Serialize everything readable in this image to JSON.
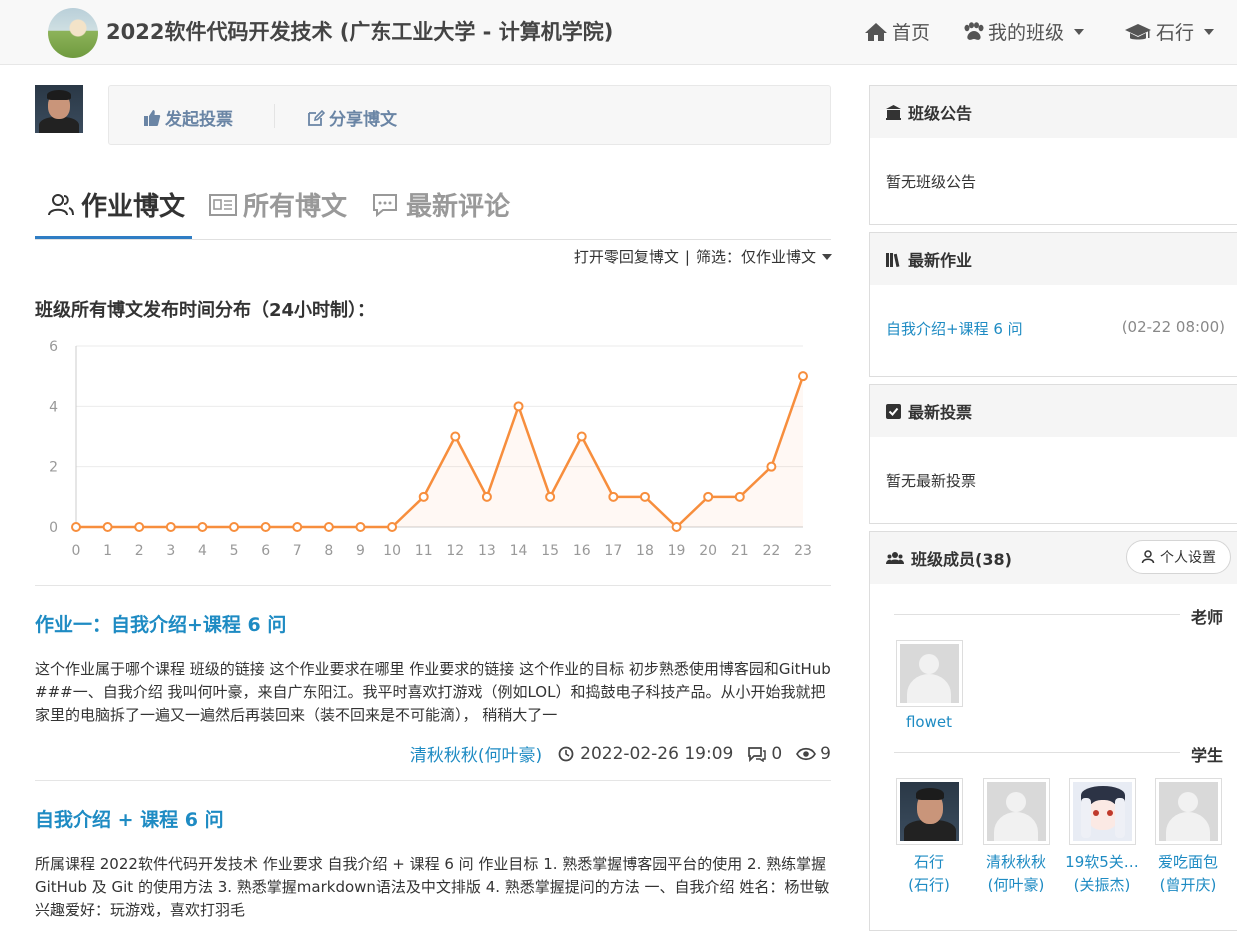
{
  "navbar": {
    "title": "2022软件代码开发技术 (广东工业大学 - 计算机学院)",
    "home": "首页",
    "my_class": "我的班级",
    "user": "石行"
  },
  "actions": {
    "vote": "发起投票",
    "share": "分享博文"
  },
  "tabs": [
    {
      "label": "作业博文",
      "icon": "users-icon"
    },
    {
      "label": "所有博文",
      "icon": "blog-icon"
    },
    {
      "label": "最新评论",
      "icon": "comments-icon"
    }
  ],
  "filter": {
    "zero_reply": "打开零回复博文",
    "separator": "|",
    "filter_label": "筛选：仅作业博文"
  },
  "chart_title": "班级所有博文发布时间分布（24小时制）：",
  "chart_data": {
    "type": "area",
    "title": "",
    "categories": [
      "0",
      "1",
      "2",
      "3",
      "4",
      "5",
      "6",
      "7",
      "8",
      "9",
      "10",
      "11",
      "12",
      "13",
      "14",
      "15",
      "16",
      "17",
      "18",
      "19",
      "20",
      "21",
      "22",
      "23"
    ],
    "series": [
      {
        "values": [
          0,
          0,
          0,
          0,
          0,
          0,
          0,
          0,
          0,
          0,
          0,
          1,
          3,
          1,
          4,
          1,
          3,
          1,
          1,
          0,
          1,
          1,
          2,
          5
        ]
      }
    ],
    "ylim": [
      0,
      6
    ],
    "yticks": [
      0,
      2,
      4,
      6
    ],
    "color": "#f78e3d",
    "grid": true
  },
  "posts": [
    {
      "title": "作业一：自我介绍+课程 6 问",
      "summary": "这个作业属于哪个课程 班级的链接 这个作业要求在哪里 作业要求的链接 这个作业的目标 初步熟悉使用博客园和GitHub ###一、自我介绍 我叫何叶豪，来自广东阳江。我平时喜欢打游戏（例如LOL）和捣鼓电子科技产品。从小开始我就把家里的电脑拆了一遍又一遍然后再装回来（装不回来是不可能滴）， 稍稍大了一",
      "author": "清秋秋秋(何叶豪)",
      "time": "2022-02-26 19:09",
      "comments": "0",
      "views": "9"
    },
    {
      "title": "自我介绍 + 课程 6 问",
      "summary": "所属课程 2022软件代码开发技术 作业要求 自我介绍 + 课程 6 问 作业目标 1. 熟悉掌握博客园平台的使用 2. 熟练掌握 GitHub 及 Git 的使用方法 3. 熟悉掌握markdown语法及中文排版 4. 熟悉掌握提问的方法 一、自我介绍 姓名：杨世敏 兴趣爱好：玩游戏，喜欢打羽毛"
    }
  ],
  "sidebar": {
    "notice": {
      "title": "班级公告",
      "body": "暂无班级公告"
    },
    "homework": {
      "title": "最新作业",
      "item": "自我介绍+课程 6 问",
      "time": "(02-22 08:00)"
    },
    "vote": {
      "title": "最新投票",
      "body": "暂无最新投票"
    },
    "members": {
      "title": "班级成员(38)",
      "settings": "个人设置",
      "teacher_label": "老师",
      "student_label": "学生",
      "teachers": [
        {
          "name": "flowet"
        }
      ],
      "students": [
        {
          "name": "石行",
          "nick": "(石行)"
        },
        {
          "name": "清秋秋秋",
          "nick": "(何叶豪)"
        },
        {
          "name": "19软5关…",
          "nick": "(关振杰)"
        },
        {
          "name": "爱吃面包",
          "nick": "(曾开庆)"
        }
      ]
    }
  }
}
